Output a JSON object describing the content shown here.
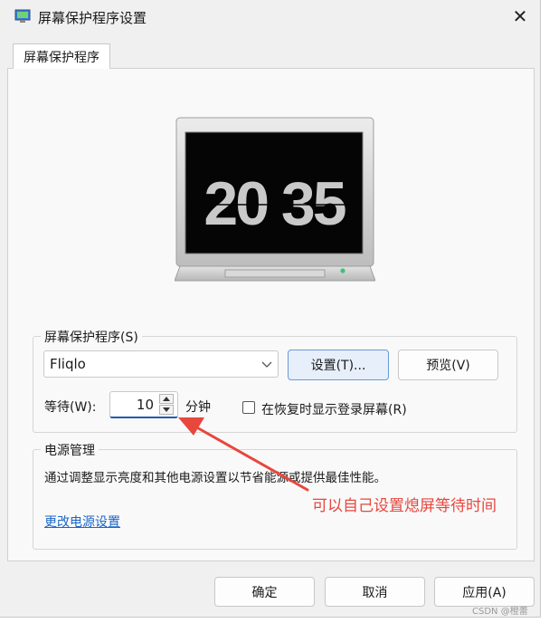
{
  "window": {
    "title": "屏幕保护程序设置",
    "close_glyph": "✕"
  },
  "tabs": [
    {
      "label": "屏幕保护程序"
    }
  ],
  "preview": {
    "clock_time": "20 35",
    "screen_color": "#050505",
    "frame_color": "#d8d8d8",
    "power_led_color": "#3ec27a"
  },
  "screensaver_group": {
    "legend": "屏幕保护程序(S)",
    "selected_screensaver": "Fliqlo",
    "settings_button": "设置(T)...",
    "preview_button": "预览(V)",
    "wait_label": "等待(W):",
    "wait_value": "10",
    "wait_unit": "分钟",
    "resume_checkbox_label": "在恢复时显示登录屏幕(R)",
    "resume_checked": false
  },
  "power_group": {
    "legend": "电源管理",
    "description": "通过调整显示亮度和其他电源设置以节省能源或提供最佳性能。",
    "link": "更改电源设置"
  },
  "footer": {
    "ok_button": "确定",
    "cancel_button": "取消",
    "apply_button": "应用(A)"
  },
  "annotation": {
    "text": "可以自己设置熄屏等待时间",
    "color": "#e8473d"
  },
  "watermark": "CSDN @橙蕾"
}
